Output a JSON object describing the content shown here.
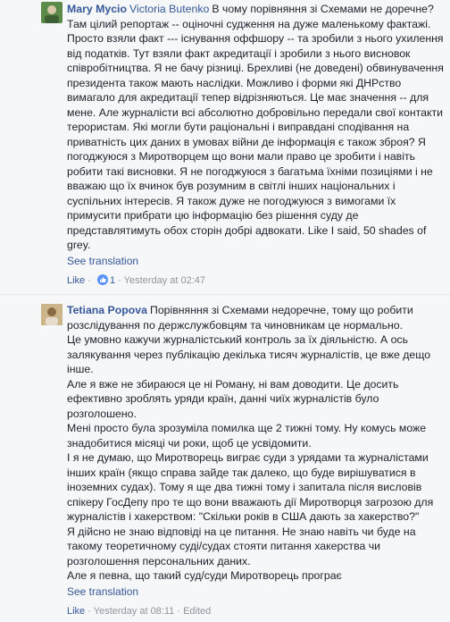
{
  "comments": [
    {
      "author": "Mary Mycio",
      "mention": "Victoria Butenko",
      "paragraphs": [
        "В чому порівняння зі Схемами не доречне? Там цілий репортаж -- оціночні судження на дуже маленькому фактажі. Просто взяли факт --- існування оффшору -- та зробили з нього ухилення від податків. Тут взяли факт акредитації і зробили з нього висновок співробітництва. Я не бачу різниці. Брехливі (не доведені) обвинувачення президента також мають наслідки. Можливо і форми які ДНРство вимагало для акредитації тепер відрізняються. Це має значення -- для мене. Але журналісти всі абсолютно добровільно передали свої контакти терористам. Які могли бути раціональні і виправдані сподівання на приватність цих даних в умовах війни де інформація є також зброя? Я погоджуюся з Миротворцем що вони мали право це зробити і навіть робити такі висновки. Я не погоджуюся з багатьма їхніми позиціями і не вважаю що їх вчинок був розумним в світлі інших національних і суспільних інтересів. Я також дуже не погоджуюся з вимогами їх примусити прибрати цю інформацію без рішення суду де представлятимуть обох сторін добрі адвокати. Like I said, 50 shades of grey."
      ],
      "see_translation": "See translation",
      "like": "Like",
      "like_count": "1",
      "time": "Yesterday at 02:47",
      "edited": ""
    },
    {
      "author": "Tetiana Popova",
      "mention": "",
      "paragraphs": [
        "Порівняння зі Схемами недоречне, тому що робити розслідування по держслужбовцям та чиновникам це нормально.",
        "Це умовно кажучи журналістський контроль за їх діяльністю. А ось залякування через публікацію декілька тисяч журналістів, це вже дещо інше.",
        "Але я вже не збираюся це ні Роману, ні вам доводити. Це досить ефективно зроблять уряди країн, данні чиїх журналістів було розголошено.",
        "Мені просто була зрозуміла помилка ще 2 тижні тому. Ну комусь може знадобитися місяці чи роки, щоб це усвідомити.",
        "І я не думаю, що Миротворець виграє суди з урядами та журналістами інших країн (якщо справа зайде так далеко, що буде вирішуватися в іноземних судах). Тому я ще два тижні тому і запитала після висловів спікеру ГосДепу про те що вони вважають дії Миротворця загрозою для журналістів і хакерством: \"Скільки років в США дають за хакерство?\"",
        "Я дійсно не знаю відповіді на це питання. Не знаю навіть чи буде на такому теоретичному суді/судах стояти питання хакерства чи розголошення персональних даних.",
        "Але я певна, що такий суд/суди Миротворець програє"
      ],
      "see_translation": "See translation",
      "like": "Like",
      "like_count": "",
      "time": "Yesterday at 08:11",
      "edited": "Edited"
    }
  ]
}
